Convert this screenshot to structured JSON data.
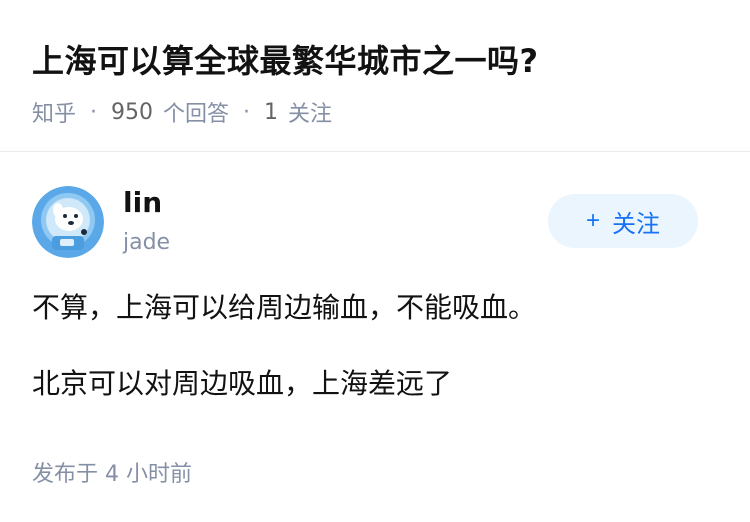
{
  "question": {
    "title": "上海可以算全球最繁华城市之一吗?",
    "source": "知乎",
    "answer_count": "950",
    "answer_label": "个回答",
    "follow_count": "1",
    "follow_label": "关注"
  },
  "author": {
    "name": "lin",
    "bio": "jade",
    "follow_button": "关注",
    "avatar_icon": "dog-astronaut-avatar-icon"
  },
  "answer": {
    "paragraphs": [
      "不算，上海可以给周边输血，不能吸血。",
      "北京可以对周边吸血，上海差远了"
    ]
  },
  "footer": {
    "published": "发布于 4 小时前"
  },
  "colors": {
    "accent": "#1772f6",
    "button_bg": "#ebf5fd",
    "meta_text": "#8590a6"
  }
}
